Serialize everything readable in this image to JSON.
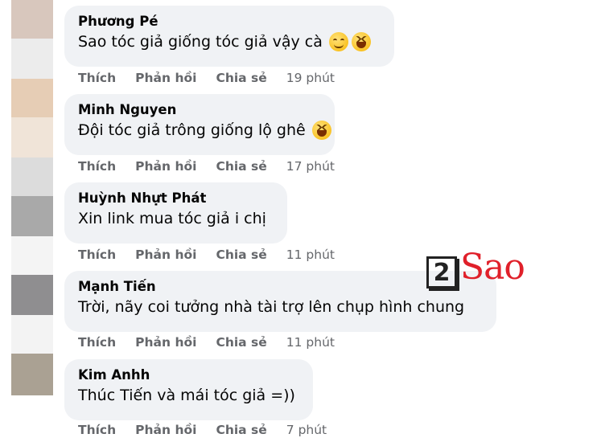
{
  "actions": {
    "like": "Thích",
    "reply": "Phản hồi",
    "share": "Chia sẻ"
  },
  "comments": [
    {
      "author": "Phương Pé",
      "text": "Sao tóc giả giống tóc giả vậy cà",
      "time": "19 phút"
    },
    {
      "author": "Minh Nguyen",
      "text": "Đội tóc giả trông giống lộ ghê",
      "time": "17 phút"
    },
    {
      "author": "Huỳnh Nhựt Phát",
      "text": "Xin link mua tóc giả i chị",
      "time": "11 phút"
    },
    {
      "author": "Mạnh Tiến",
      "text": "Trời, nãy coi tưởng nhà tài trợ lên chụp hình chung",
      "time": "11 phút"
    },
    {
      "author": "Kim Anhh",
      "text": "Thúc Tiến và mái tóc giả =))",
      "time": "7 phút"
    }
  ],
  "watermark": {
    "number": "2",
    "word": "Sao"
  }
}
